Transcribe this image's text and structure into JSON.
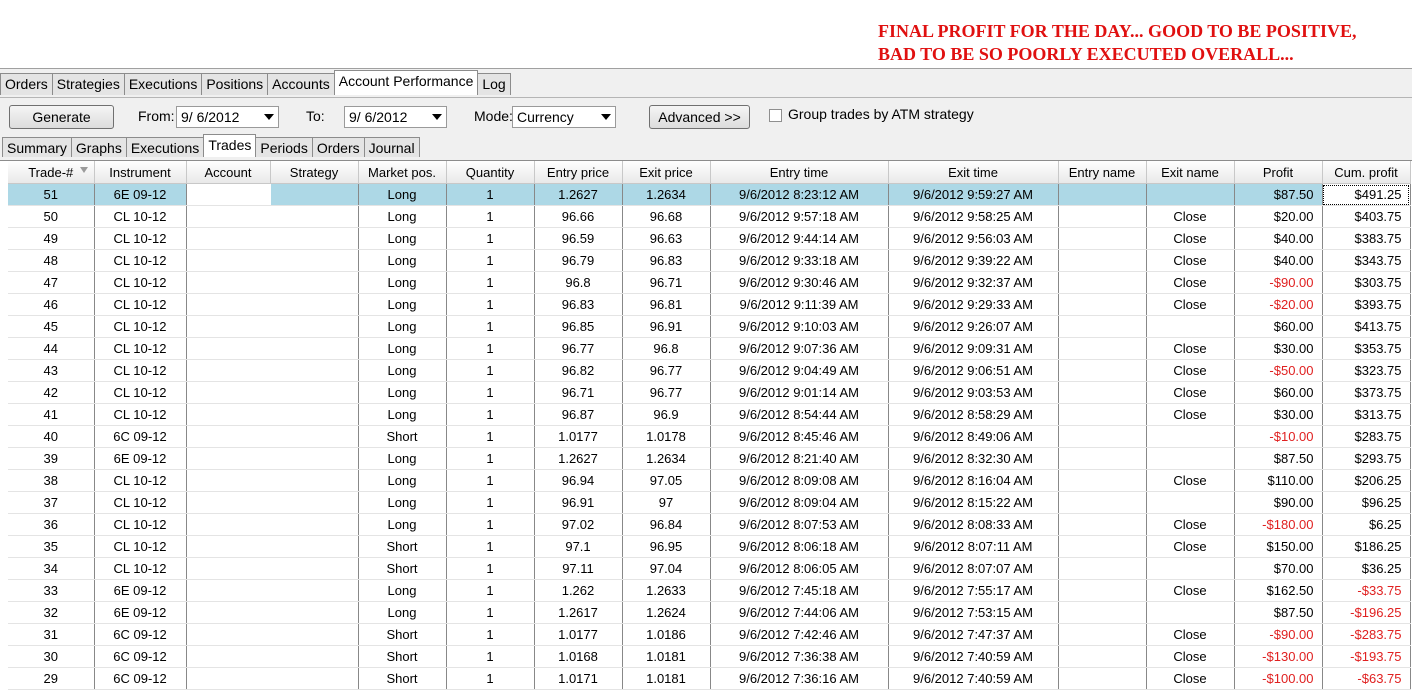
{
  "annotation": {
    "text": "FINAL PROFIT FOR THE DAY... GOOD TO BE POSITIVE, BAD TO BE SO POORLY EXECUTED OVERALL..."
  },
  "top_tabs": [
    "Orders",
    "Strategies",
    "Executions",
    "Positions",
    "Accounts",
    "Account Performance",
    "Log"
  ],
  "toolbar": {
    "generate_label": "Generate",
    "from_label": "From:",
    "from_value": "9/  6/2012",
    "to_label": "To:",
    "to_value": "9/  6/2012",
    "mode_label": "Mode:",
    "mode_value": "Currency",
    "advanced_label": "Advanced >>",
    "group_label": "Group trades by ATM strategy"
  },
  "sub_tabs": [
    "Summary",
    "Graphs",
    "Executions",
    "Trades",
    "Periods",
    "Orders",
    "Journal"
  ],
  "columns": [
    "Trade-#",
    "Instrument",
    "Account",
    "Strategy",
    "Market pos.",
    "Quantity",
    "Entry price",
    "Exit price",
    "Entry time",
    "Exit time",
    "Entry name",
    "Exit name",
    "Profit",
    "Cum. profit"
  ],
  "rows": [
    [
      "51",
      "6E 09-12",
      "",
      "",
      "Long",
      "1",
      "1.2627",
      "1.2634",
      "9/6/2012 8:23:12 AM",
      "9/6/2012 9:59:27 AM",
      "",
      "",
      "$87.50",
      "$491.25"
    ],
    [
      "50",
      "CL 10-12",
      "",
      "",
      "Long",
      "1",
      "96.66",
      "96.68",
      "9/6/2012 9:57:18 AM",
      "9/6/2012 9:58:25 AM",
      "",
      "Close",
      "$20.00",
      "$403.75"
    ],
    [
      "49",
      "CL 10-12",
      "",
      "",
      "Long",
      "1",
      "96.59",
      "96.63",
      "9/6/2012 9:44:14 AM",
      "9/6/2012 9:56:03 AM",
      "",
      "Close",
      "$40.00",
      "$383.75"
    ],
    [
      "48",
      "CL 10-12",
      "",
      "",
      "Long",
      "1",
      "96.79",
      "96.83",
      "9/6/2012 9:33:18 AM",
      "9/6/2012 9:39:22 AM",
      "",
      "Close",
      "$40.00",
      "$343.75"
    ],
    [
      "47",
      "CL 10-12",
      "",
      "",
      "Long",
      "1",
      "96.8",
      "96.71",
      "9/6/2012 9:30:46 AM",
      "9/6/2012 9:32:37 AM",
      "",
      "Close",
      "-$90.00",
      "$303.75"
    ],
    [
      "46",
      "CL 10-12",
      "",
      "",
      "Long",
      "1",
      "96.83",
      "96.81",
      "9/6/2012 9:11:39 AM",
      "9/6/2012 9:29:33 AM",
      "",
      "Close",
      "-$20.00",
      "$393.75"
    ],
    [
      "45",
      "CL 10-12",
      "",
      "",
      "Long",
      "1",
      "96.85",
      "96.91",
      "9/6/2012 9:10:03 AM",
      "9/6/2012 9:26:07 AM",
      "",
      "",
      "$60.00",
      "$413.75"
    ],
    [
      "44",
      "CL 10-12",
      "",
      "",
      "Long",
      "1",
      "96.77",
      "96.8",
      "9/6/2012 9:07:36 AM",
      "9/6/2012 9:09:31 AM",
      "",
      "Close",
      "$30.00",
      "$353.75"
    ],
    [
      "43",
      "CL 10-12",
      "",
      "",
      "Long",
      "1",
      "96.82",
      "96.77",
      "9/6/2012 9:04:49 AM",
      "9/6/2012 9:06:51 AM",
      "",
      "Close",
      "-$50.00",
      "$323.75"
    ],
    [
      "42",
      "CL 10-12",
      "",
      "",
      "Long",
      "1",
      "96.71",
      "96.77",
      "9/6/2012 9:01:14 AM",
      "9/6/2012 9:03:53 AM",
      "",
      "Close",
      "$60.00",
      "$373.75"
    ],
    [
      "41",
      "CL 10-12",
      "",
      "",
      "Long",
      "1",
      "96.87",
      "96.9",
      "9/6/2012 8:54:44 AM",
      "9/6/2012 8:58:29 AM",
      "",
      "Close",
      "$30.00",
      "$313.75"
    ],
    [
      "40",
      "6C 09-12",
      "",
      "",
      "Short",
      "1",
      "1.0177",
      "1.0178",
      "9/6/2012 8:45:46 AM",
      "9/6/2012 8:49:06 AM",
      "",
      "",
      "-$10.00",
      "$283.75"
    ],
    [
      "39",
      "6E 09-12",
      "",
      "",
      "Long",
      "1",
      "1.2627",
      "1.2634",
      "9/6/2012 8:21:40 AM",
      "9/6/2012 8:32:30 AM",
      "",
      "",
      "$87.50",
      "$293.75"
    ],
    [
      "38",
      "CL 10-12",
      "",
      "",
      "Long",
      "1",
      "96.94",
      "97.05",
      "9/6/2012 8:09:08 AM",
      "9/6/2012 8:16:04 AM",
      "",
      "Close",
      "$110.00",
      "$206.25"
    ],
    [
      "37",
      "CL 10-12",
      "",
      "",
      "Long",
      "1",
      "96.91",
      "97",
      "9/6/2012 8:09:04 AM",
      "9/6/2012 8:15:22 AM",
      "",
      "",
      "$90.00",
      "$96.25"
    ],
    [
      "36",
      "CL 10-12",
      "",
      "",
      "Long",
      "1",
      "97.02",
      "96.84",
      "9/6/2012 8:07:53 AM",
      "9/6/2012 8:08:33 AM",
      "",
      "Close",
      "-$180.00",
      "$6.25"
    ],
    [
      "35",
      "CL 10-12",
      "",
      "",
      "Short",
      "1",
      "97.1",
      "96.95",
      "9/6/2012 8:06:18 AM",
      "9/6/2012 8:07:11 AM",
      "",
      "Close",
      "$150.00",
      "$186.25"
    ],
    [
      "34",
      "CL 10-12",
      "",
      "",
      "Short",
      "1",
      "97.11",
      "97.04",
      "9/6/2012 8:06:05 AM",
      "9/6/2012 8:07:07 AM",
      "",
      "",
      "$70.00",
      "$36.25"
    ],
    [
      "33",
      "6E 09-12",
      "",
      "",
      "Long",
      "1",
      "1.262",
      "1.2633",
      "9/6/2012 7:45:18 AM",
      "9/6/2012 7:55:17 AM",
      "",
      "Close",
      "$162.50",
      "-$33.75"
    ],
    [
      "32",
      "6E 09-12",
      "",
      "",
      "Long",
      "1",
      "1.2617",
      "1.2624",
      "9/6/2012 7:44:06 AM",
      "9/6/2012 7:53:15 AM",
      "",
      "",
      "$87.50",
      "-$196.25"
    ],
    [
      "31",
      "6C 09-12",
      "",
      "",
      "Short",
      "1",
      "1.0177",
      "1.0186",
      "9/6/2012 7:42:46 AM",
      "9/6/2012 7:47:37 AM",
      "",
      "Close",
      "-$90.00",
      "-$283.75"
    ],
    [
      "30",
      "6C 09-12",
      "",
      "",
      "Short",
      "1",
      "1.0168",
      "1.0181",
      "9/6/2012 7:36:38 AM",
      "9/6/2012 7:40:59 AM",
      "",
      "Close",
      "-$130.00",
      "-$193.75"
    ],
    [
      "29",
      "6C 09-12",
      "",
      "",
      "Short",
      "1",
      "1.0171",
      "1.0181",
      "9/6/2012 7:36:16 AM",
      "9/6/2012 7:40:59 AM",
      "",
      "Close",
      "-$100.00",
      "-$63.75"
    ]
  ],
  "colors": {
    "selected_row": "#add8e6",
    "negative": "#e02020",
    "annotation": "#e01010",
    "arrow": "#9b4fb0"
  }
}
